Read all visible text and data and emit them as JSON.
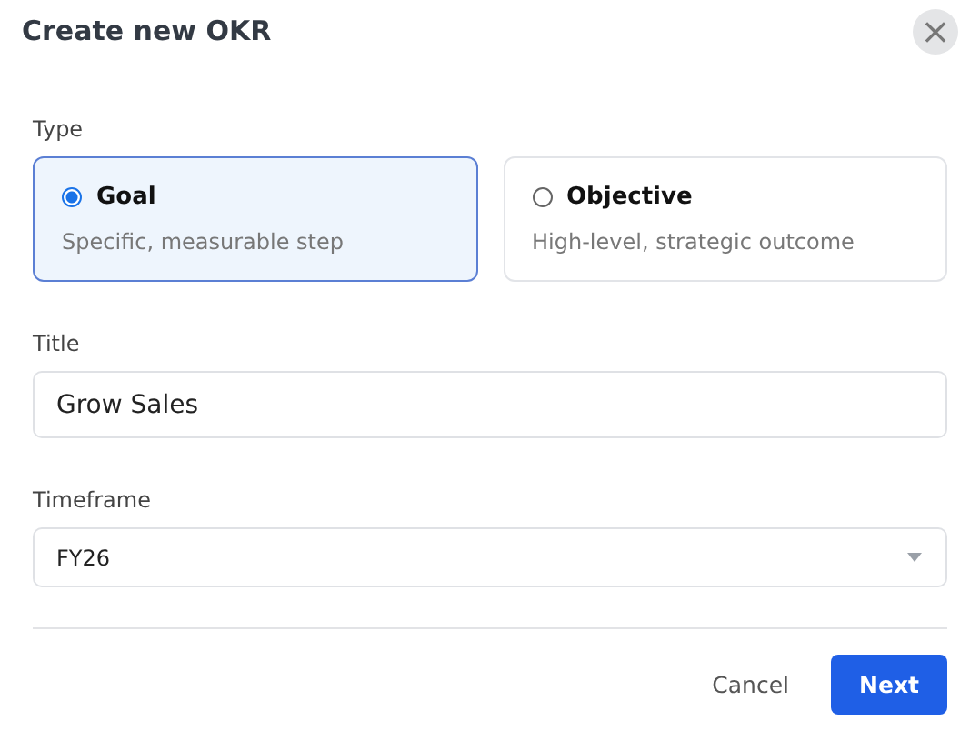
{
  "dialog": {
    "title": "Create new OKR",
    "close": "×"
  },
  "type": {
    "label": "Type",
    "options": [
      {
        "title": "Goal",
        "description": "Specific, measurable step",
        "selected": true
      },
      {
        "title": "Objective",
        "description": "High-level, strategic outcome",
        "selected": false
      }
    ]
  },
  "title_field": {
    "label": "Title",
    "value": "Grow Sales"
  },
  "timeframe": {
    "label": "Timeframe",
    "value": "FY26"
  },
  "buttons": {
    "cancel": "Cancel",
    "next": "Next"
  }
}
